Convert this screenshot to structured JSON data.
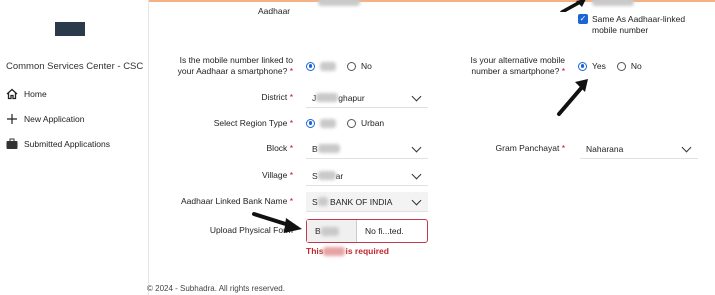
{
  "sidebar": {
    "brand": "Common Services Center - CSC",
    "items": [
      {
        "label": "Home",
        "icon": "home-icon"
      },
      {
        "label": "New Application",
        "icon": "plus-icon"
      },
      {
        "label": "Submitted Applications",
        "icon": "briefcase-icon"
      }
    ]
  },
  "form": {
    "aadhaar_label": "Aadhaar",
    "same_as_aadhaar": "Same As Aadhaar-linked mobile number",
    "mobile_linked_label_1": "Is the mobile number linked to",
    "mobile_linked_label_2": "your Aadhaar a smartphone?",
    "mobile_linked_no": "No",
    "alt_mobile_label_1": "Is your alternative mobile",
    "alt_mobile_label_2": "number a smartphone?",
    "alt_yes": "Yes",
    "alt_no": "No",
    "district_label": "District",
    "district_prefix": "J",
    "district_suffix": "ghapur",
    "region_label": "Select Region Type",
    "region_urban": "Urban",
    "block_label": "Block",
    "block_prefix": "B",
    "gram_label": "Gram Panchayat",
    "gram_value": "Naharana",
    "village_label": "Village",
    "village_prefix": "S",
    "village_suffix": "ar",
    "bank_label": "Aadhaar Linked Bank Name",
    "bank_prefix": "S",
    "bank_value": "BANK OF INDIA",
    "upload_label": "Upload Physical Form",
    "upload_btn_prefix": "B",
    "upload_filename": "No fi...ted.",
    "error_prefix": "This",
    "error_suffix": "is required",
    "required_mark": "*"
  },
  "footer": "© 2024 - Subhadra. All rights reserved.",
  "colors": {
    "accent": "#1a66d6",
    "error": "#c0262d"
  }
}
